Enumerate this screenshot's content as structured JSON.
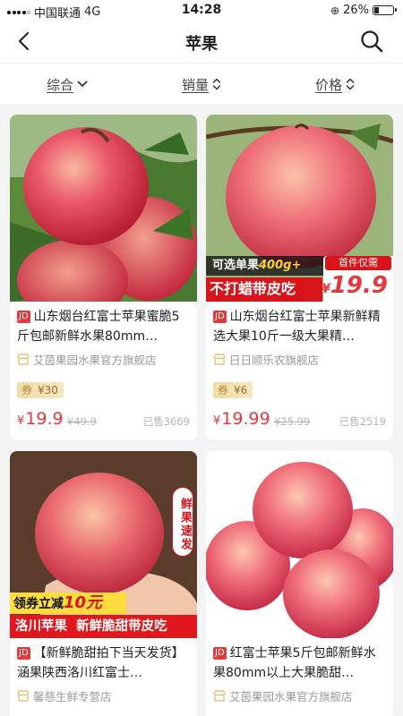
{
  "status_bar": {
    "carrier": "中国联通",
    "network": "4G",
    "time": "14:28",
    "battery": "26%",
    "battery_level": 0.26
  },
  "nav": {
    "title": "苹果",
    "back_icon": "chevron-left-icon",
    "search_icon": "search-icon"
  },
  "sort_bar": {
    "items": [
      {
        "label": "综合",
        "icon": "chevron-down-icon"
      },
      {
        "label": "销量",
        "icon": "sort-updown-icon"
      },
      {
        "label": "价格",
        "icon": "sort-updown-icon"
      }
    ]
  },
  "products": [
    {
      "badge": "JD",
      "title": "山东烟台红富士苹果蜜脆5斤包邮新鲜水果80mm…",
      "shop": "艾茵果园水果官方旗舰店",
      "coupon_tag": "券",
      "coupon_value": "¥30",
      "price_symbol": "¥",
      "price": "19.9",
      "old_price": "¥49.9",
      "sold": "已售3669"
    },
    {
      "badge": "JD",
      "title": "山东烟台红富士苹果新鲜精选大果10斤一级大果精…",
      "shop": "日日顺乐农旗舰店",
      "coupon_tag": "券",
      "coupon_value": "¥6",
      "price_symbol": "¥",
      "price": "19.99",
      "old_price": "¥25.99",
      "sold": "已售2519",
      "overlay": {
        "option": "可选单果",
        "weight": "400g+",
        "first_buy": "首件仅需",
        "promo": "不打蜡带皮吃",
        "price_symbol": "¥",
        "price": "19.9"
      }
    },
    {
      "badge": "JD",
      "title": "【新鲜脆甜拍下当天发货】涵果陕西洛川红富士…",
      "shop": "馨慈生鲜专营店",
      "overlay": {
        "fresh_badge": "鲜果速发",
        "coupon_text": "领券立减",
        "coupon_amount": "10元",
        "banner": "洛川苹果  新鲜脆甜带皮吃"
      }
    },
    {
      "badge": "JD",
      "title": "红富士苹果5斤包邮新鲜水果80mm以上大果脆甜…",
      "shop": "艾茵果园水果官方旗舰店"
    }
  ],
  "colors": {
    "accent": "#e4393c",
    "coupon_gold": "#f3dda6",
    "price_red": "#e4393c"
  }
}
